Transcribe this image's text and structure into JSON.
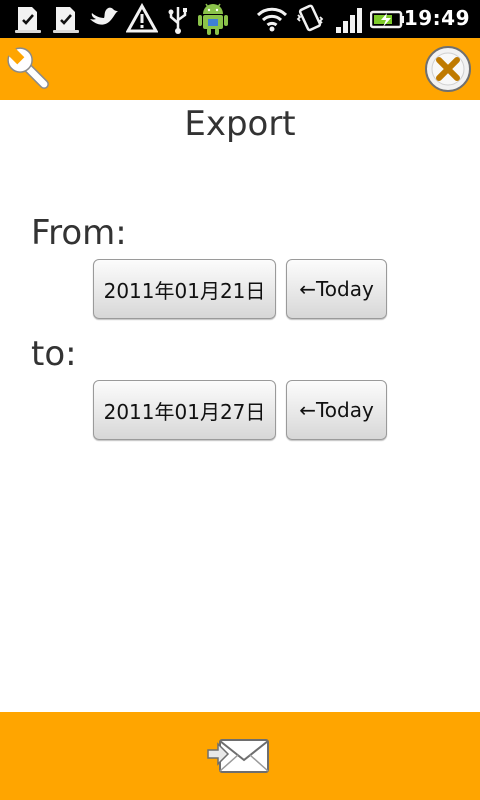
{
  "status_bar": {
    "time": "19:49",
    "icons": [
      "download-done-icon",
      "download-done-icon",
      "bird-icon",
      "warning-icon",
      "usb-icon",
      "android-icon",
      "wifi-icon",
      "vibrate-icon",
      "signal-icon",
      "battery-icon"
    ]
  },
  "toolbar": {
    "settings_icon": "wrench-icon",
    "close_icon": "close-icon",
    "accent_color": "#ffa500"
  },
  "main": {
    "title": "Export",
    "from_label": "From:",
    "to_label": "to:",
    "from_date": "2011年01月21日",
    "to_date": "2011年01月27日",
    "today_label": "←Today"
  },
  "bottom_bar": {
    "send_icon": "envelope-send-icon"
  }
}
